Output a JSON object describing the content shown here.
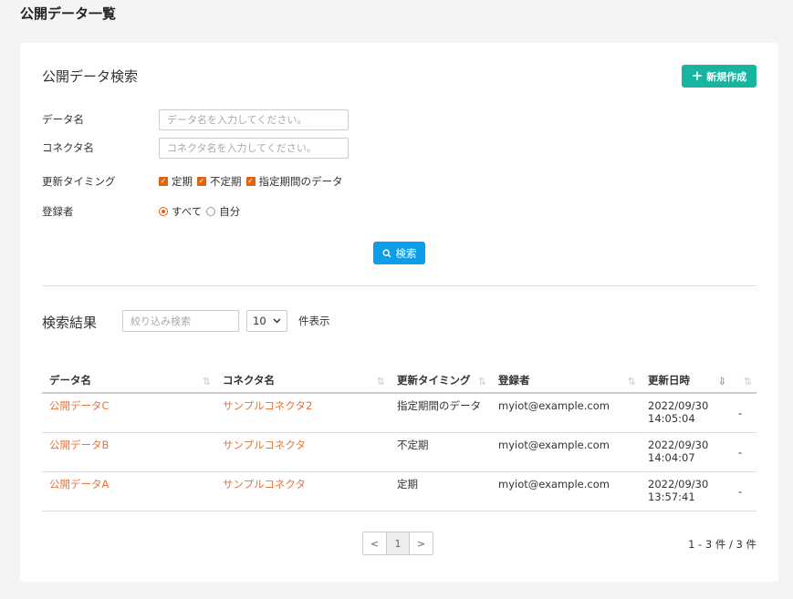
{
  "page_title": "公開データ一覧",
  "search_section": {
    "title": "公開データ検索",
    "new_button": "新規作成",
    "data_name_label": "データ名",
    "data_name_placeholder": "データ名を入力してください。",
    "data_name_value": "",
    "connector_label": "コネクタ名",
    "connector_placeholder": "コネクタ名を入力してください。",
    "connector_value": "",
    "timing_label": "更新タイミング",
    "timing_options": [
      "定期",
      "不定期",
      "指定期間のデータ"
    ],
    "registrant_label": "登録者",
    "registrant_options": [
      "すべて",
      "自分"
    ],
    "registrant_selected": "すべて",
    "search_button": "検索"
  },
  "results": {
    "title": "検索結果",
    "filter_placeholder": "絞り込み検索",
    "page_size": "10",
    "page_size_suffix": "件表示",
    "columns": [
      "データ名",
      "コネクタ名",
      "更新タイミング",
      "登録者",
      "更新日時",
      ""
    ],
    "rows": [
      {
        "data_name": "公開データC",
        "connector": "サンプルコネクタ2",
        "timing": "指定期間のデータ",
        "registrant": "myiot@example.com",
        "date": "2022/09/30",
        "time": "14:05:04",
        "extra": "-"
      },
      {
        "data_name": "公開データB",
        "connector": "サンプルコネクタ",
        "timing": "不定期",
        "registrant": "myiot@example.com",
        "date": "2022/09/30",
        "time": "14:04:07",
        "extra": "-"
      },
      {
        "data_name": "公開データA",
        "connector": "サンプルコネクタ",
        "timing": "定期",
        "registrant": "myiot@example.com",
        "date": "2022/09/30",
        "time": "13:57:41",
        "extra": "-"
      }
    ],
    "pagination": {
      "prev": "<",
      "current": "1",
      "next": ">"
    },
    "count_text": "1 - 3 件 / 3 件"
  },
  "colors": {
    "accent": "#e4620c",
    "new_button": "#17b4a0",
    "search_button": "#0e9de8",
    "link": "#e4763c"
  }
}
